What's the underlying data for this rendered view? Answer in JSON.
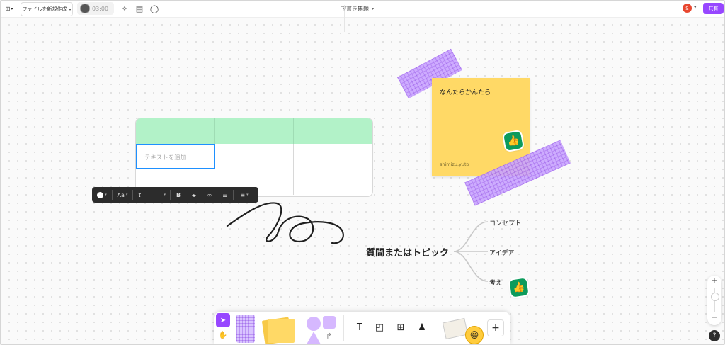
{
  "topbar": {
    "file_button": "ファイルを新規作成",
    "timer": "03:00",
    "breadcrumb_parent": "下書き",
    "breadcrumb_separator": "/",
    "document_title": "無題",
    "user_initial": "S",
    "share_label": "共有"
  },
  "table": {
    "placeholder": "テキストを追加"
  },
  "format_toolbar": {
    "font_label": "Aa"
  },
  "sticky": {
    "text": "なんたらかんたら",
    "author": "shimizu.yuto"
  },
  "mindmap": {
    "topic": "質問またはトピック",
    "branches": [
      "コンセプト",
      "アイデア",
      "考え"
    ]
  },
  "zoom": {
    "plus": "+",
    "minus": "−"
  },
  "help_label": "?",
  "icons": {
    "menu": "figjam-menu-icon",
    "timer_avatar": "timer-avatar-icon",
    "sparkle": "sparkle-icon",
    "layout": "layout-icon",
    "comment": "comment-icon",
    "thumbs_up": "thumbs-up-icon",
    "text_tool": "text-tool-icon",
    "section_tool": "section-tool-icon",
    "table_tool": "table-tool-icon",
    "stamp_tool": "stamp-tool-icon"
  },
  "colors": {
    "accent": "#9747ff",
    "sticky": "#ffd966",
    "table_header": "#b2f2c8",
    "selection": "#1e90ff",
    "sticker": "#0d9b5c",
    "tape": "#c9a4ff"
  }
}
